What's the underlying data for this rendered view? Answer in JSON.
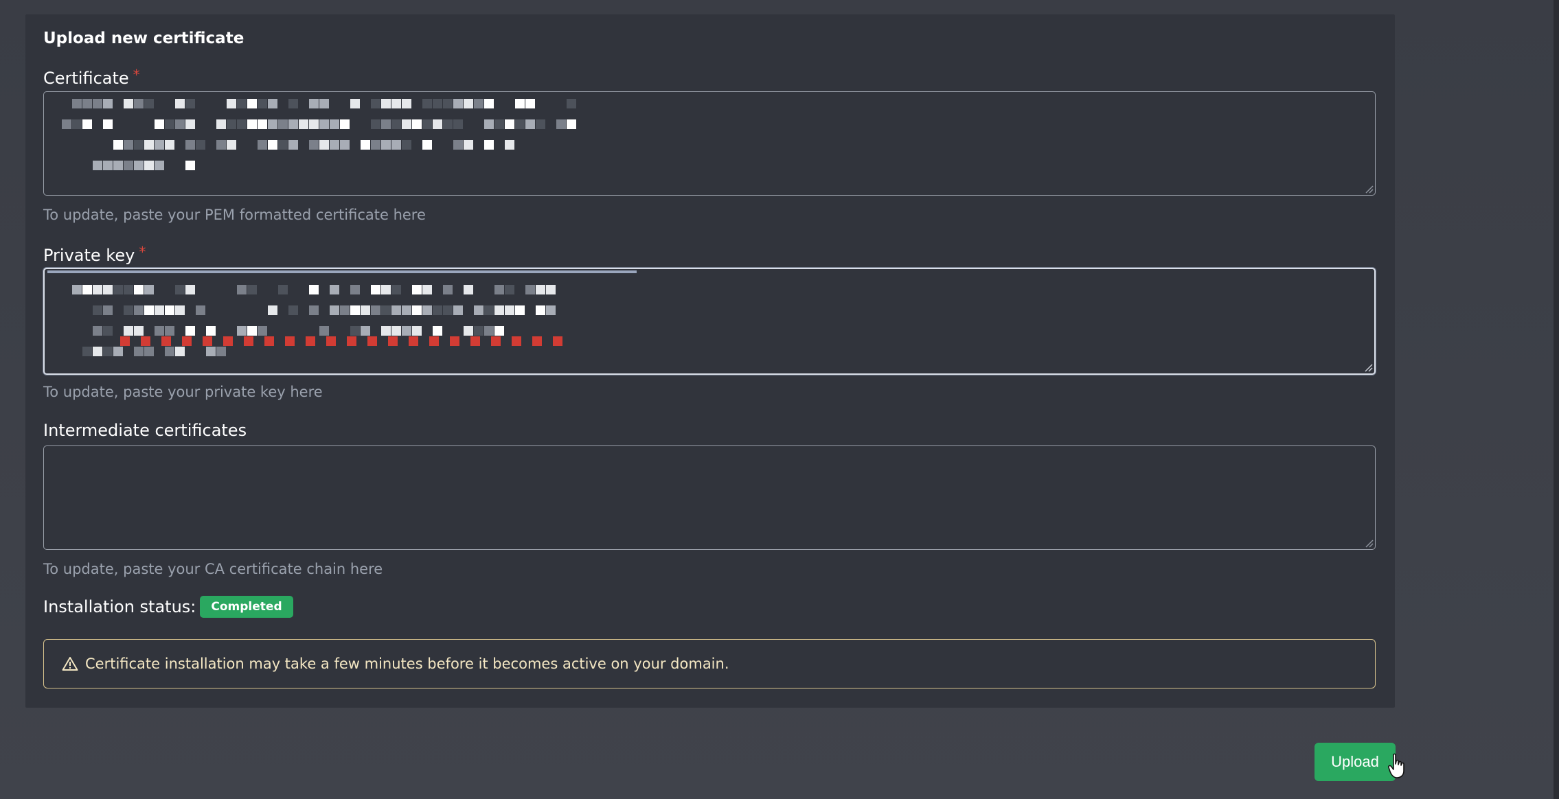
{
  "card": {
    "title": "Upload new certificate",
    "certificate": {
      "label": "Certificate",
      "required_marker": "*",
      "help": "To update, paste your PEM formatted certificate here",
      "value_state": "redacted"
    },
    "private_key": {
      "label": "Private key",
      "required_marker": "*",
      "help": "To update, paste your private key here",
      "value_state": "redacted"
    },
    "intermediate": {
      "label": "Intermediate certificates",
      "help": "To update, paste your CA certificate chain here",
      "value": ""
    },
    "status": {
      "label": "Installation status:",
      "badge": "Completed",
      "badge_color": "#2aa860"
    },
    "alert": {
      "icon": "warning-triangle-icon",
      "text": "Certificate installation may take a few minutes before it becomes active on your domain.",
      "border_color": "#d9c48e"
    }
  },
  "actions": {
    "upload_label": "Upload",
    "upload_color": "#2aa860"
  },
  "colors": {
    "background": "#3c3f47",
    "card": "#31343c",
    "required": "#e0483c",
    "help_text": "#9aa1ad"
  }
}
